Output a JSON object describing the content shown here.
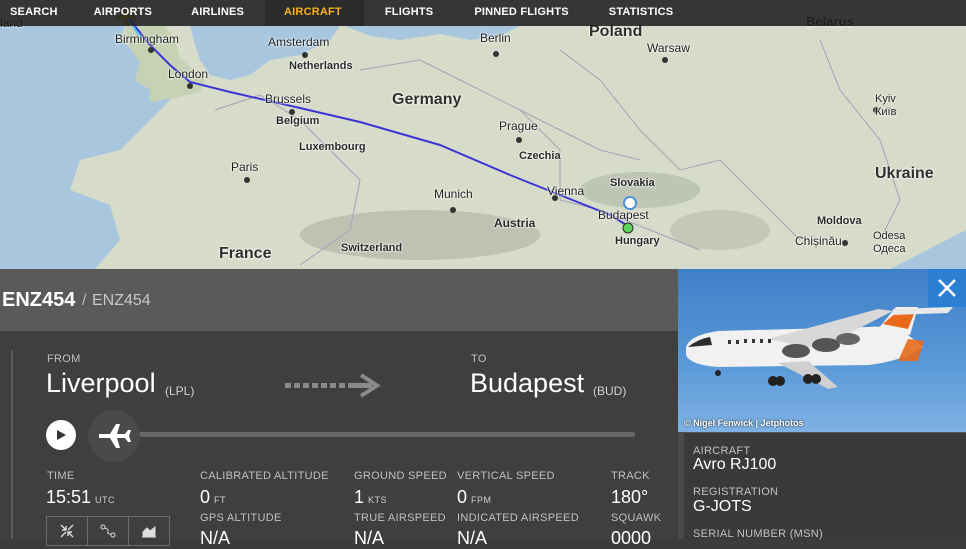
{
  "nav": {
    "items": [
      {
        "label": "SEARCH"
      },
      {
        "label": "AIRPORTS"
      },
      {
        "label": "AIRLINES"
      },
      {
        "label": "AIRCRAFT"
      },
      {
        "label": "FLIGHTS"
      },
      {
        "label": "PINNED FLIGHTS"
      },
      {
        "label": "STATISTICS"
      }
    ],
    "active": "AIRCRAFT",
    "accent_color": "#f5b323"
  },
  "map": {
    "labels": {
      "land": "land",
      "birmingham": "Birmingham",
      "london": "London",
      "amsterdam": "Amsterdam",
      "netherlands": "Netherlands",
      "berlin": "Berlin",
      "poland": "Poland",
      "warsaw": "Warsaw",
      "belarus": "Belarus",
      "brussels": "Brussels",
      "belgium": "Belgium",
      "germany": "Germany",
      "prague": "Prague",
      "kyiv": "Kyiv",
      "kyiv_local": "Київ",
      "luxembourg": "Luxembourg",
      "czechia": "Czechia",
      "paris": "Paris",
      "slovakia": "Slovakia",
      "ukraine": "Ukraine",
      "vienna": "Vienna",
      "munich": "Munich",
      "budapest": "Budapest",
      "austria": "Austria",
      "moldova": "Moldova",
      "hungary": "Hungary",
      "switzerland": "Switzerland",
      "chisinau": "Chișinău",
      "odesa": "Odesa",
      "odesa_local": "Одеса",
      "france": "France"
    },
    "route_color": "#3a36d6"
  },
  "flight": {
    "callsign": "ENZ454",
    "separator": "/",
    "callsign_alt": "ENZ454",
    "from_label": "FROM",
    "from_city": "Liverpool",
    "from_code": "(LPL)",
    "to_label": "TO",
    "to_city": "Budapest",
    "to_code": "(BUD)",
    "progress": 0.0
  },
  "stats": {
    "time_label": "TIME",
    "time_value": "15:51",
    "time_unit": "UTC",
    "cal_alt_label": "CALIBRATED ALTITUDE",
    "cal_alt_value": "0",
    "cal_alt_unit": "FT",
    "gps_alt_label": "GPS ALTITUDE",
    "gps_alt_value": "N/A",
    "ground_speed_label": "GROUND SPEED",
    "ground_speed_value": "1",
    "ground_speed_unit": "KTS",
    "true_airspeed_label": "TRUE AIRSPEED",
    "true_airspeed_value": "N/A",
    "vertical_speed_label": "VERTICAL SPEED",
    "vertical_speed_value": "0",
    "vertical_speed_unit": "FPM",
    "indicated_airspeed_label": "INDICATED AIRSPEED",
    "indicated_airspeed_value": "N/A",
    "track_label": "TRACK",
    "track_value": "180°",
    "squawk_label": "SQUAWK",
    "squawk_value": "0000"
  },
  "aircraft": {
    "photo_credit": "© Nigel Fenwick | Jetphotos",
    "aircraft_label": "AIRCRAFT",
    "aircraft_value": "Avro RJ100",
    "registration_label": "REGISTRATION",
    "registration_value": "G-JOTS",
    "serial_label": "SERIAL NUMBER (MSN)"
  }
}
